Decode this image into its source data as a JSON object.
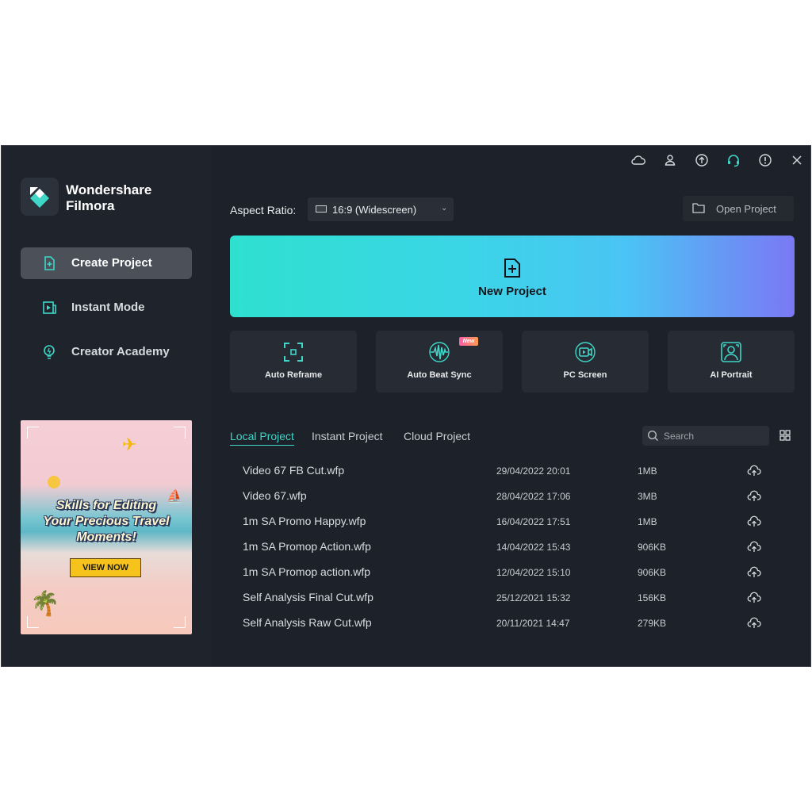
{
  "app": {
    "brand_line1": "Wondershare",
    "brand_line2": "Filmora",
    "accent_color": "#3fd7c8"
  },
  "sidebar": {
    "items": [
      {
        "label": "Create Project",
        "icon": "new-file-icon",
        "active": true
      },
      {
        "label": "Instant Mode",
        "icon": "instant-mode-icon",
        "active": false
      },
      {
        "label": "Creator Academy",
        "icon": "lightbulb-icon",
        "active": false
      }
    ],
    "promo": {
      "headline_line1": "Skills for Editing",
      "headline_line2": "Your Precious Travel",
      "headline_line3": "Moments!",
      "cta": "VIEW NOW"
    }
  },
  "titlebar": {
    "icons": [
      "cloud-icon",
      "user-icon",
      "upload-icon",
      "headset-icon",
      "info-icon",
      "close-icon"
    ]
  },
  "toolbar": {
    "aspect_label": "Aspect Ratio:",
    "aspect_value": "16:9 (Widescreen)",
    "open_project": "Open Project"
  },
  "new_project": {
    "label": "New Project"
  },
  "tools": [
    {
      "label": "Auto Reframe",
      "icon": "reframe-icon",
      "badge": ""
    },
    {
      "label": "Auto Beat Sync",
      "icon": "beat-sync-icon",
      "badge": "New"
    },
    {
      "label": "PC Screen",
      "icon": "screen-record-icon",
      "badge": ""
    },
    {
      "label": "AI Portrait",
      "icon": "portrait-icon",
      "badge": ""
    }
  ],
  "projects": {
    "tabs": [
      "Local Project",
      "Instant Project",
      "Cloud Project"
    ],
    "active_tab": "Local Project",
    "search_placeholder": "Search",
    "rows": [
      {
        "name": "Video 67 FB Cut.wfp",
        "date": "29/04/2022 20:01",
        "size": "1MB"
      },
      {
        "name": "Video 67.wfp",
        "date": "28/04/2022 17:06",
        "size": "3MB"
      },
      {
        "name": "1m SA Promo Happy.wfp",
        "date": "16/04/2022 17:51",
        "size": "1MB"
      },
      {
        "name": "1m SA Promop Action.wfp",
        "date": "14/04/2022 15:43",
        "size": "906KB"
      },
      {
        "name": "1m SA Promop action.wfp",
        "date": "12/04/2022 15:10",
        "size": "906KB"
      },
      {
        "name": "Self Analysis Final Cut.wfp",
        "date": "25/12/2021 15:32",
        "size": "156KB"
      },
      {
        "name": "Self Analysis Raw Cut.wfp",
        "date": "20/11/2021 14:47",
        "size": "279KB"
      }
    ]
  }
}
